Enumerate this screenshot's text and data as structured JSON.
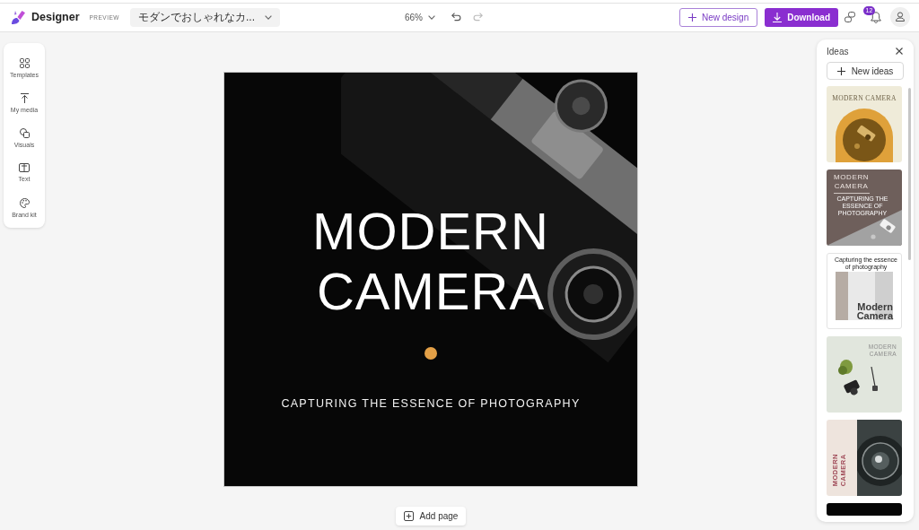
{
  "header": {
    "app_name": "Designer",
    "badge": "PREVIEW",
    "document_title": "モダンでおしゃれなカ...",
    "zoom": "66%",
    "history": [
      {
        "kind": "undo",
        "disabled": false
      },
      {
        "kind": "redo",
        "disabled": true
      }
    ],
    "actions": [
      {
        "kind": "outline",
        "label": "New design"
      },
      {
        "kind": "primary",
        "label": "Download"
      }
    ],
    "notification_count": "12"
  },
  "sidebar": {
    "items": [
      {
        "label": "Templates"
      },
      {
        "label": "My media"
      },
      {
        "label": "Visuals"
      },
      {
        "label": "Text"
      },
      {
        "label": "Brand kit"
      }
    ]
  },
  "canvas": {
    "title": "MODERN CAMERA",
    "subtitle": "CAPTURING THE ESSENCE OF PHOTOGRAPHY",
    "add_page": "Add page"
  },
  "ideas": {
    "title": "Ideas",
    "new_button": "New ideas",
    "designs": [
      {
        "kind": "arch",
        "title": "MODERN CAMERA"
      },
      {
        "kind": "diagonal",
        "title": "MODERN CAMERA",
        "subtitle": "CAPTURING THE ESSENCE OF PHOTOGRAPHY"
      },
      {
        "kind": "photo-card",
        "caption": "Capturing the essence of photography",
        "title": "Modern Camera"
      },
      {
        "kind": "flatlay",
        "title": "MODERN CAMERA"
      },
      {
        "kind": "lens",
        "title": "MODERN CAMERA"
      },
      {
        "kind": "dark"
      }
    ]
  }
}
